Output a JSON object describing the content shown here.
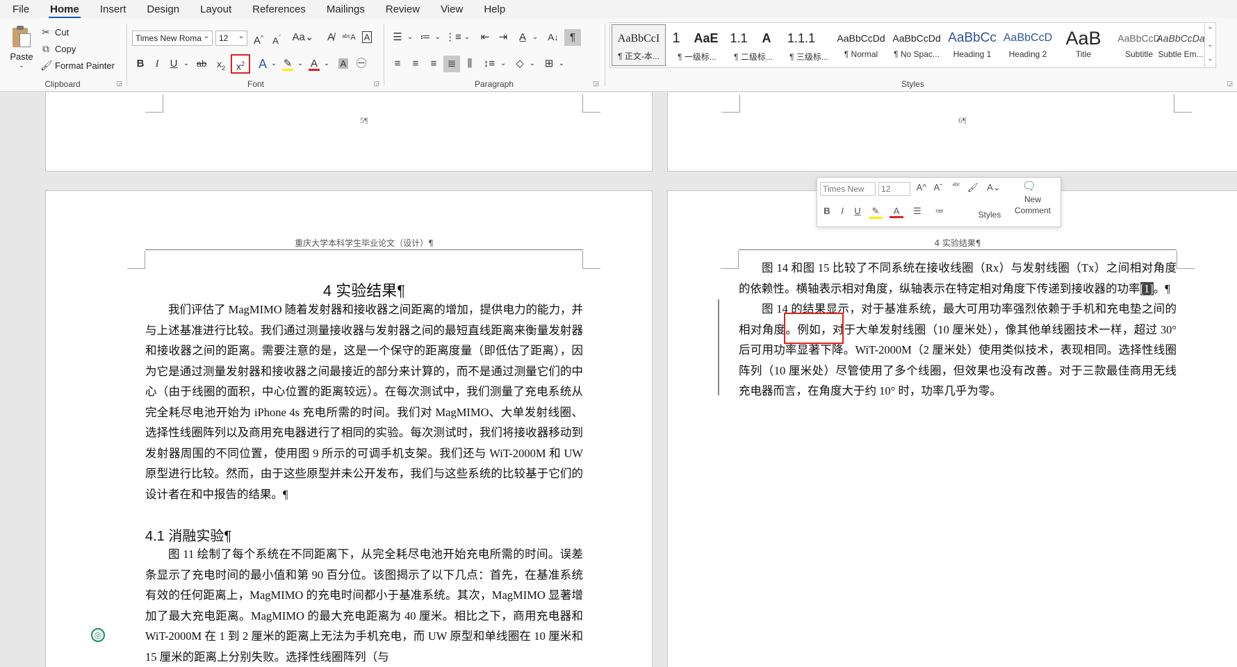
{
  "menu": [
    "File",
    "Home",
    "Insert",
    "Design",
    "Layout",
    "References",
    "Mailings",
    "Review",
    "View",
    "Help"
  ],
  "clipboard": {
    "paste_label": "Paste",
    "cut_label": "Cut",
    "copy_label": "Copy",
    "format_painter_label": "Format Painter",
    "group_label": "Clipboard"
  },
  "font": {
    "family": "Times New Roma",
    "size": "12",
    "group_label": "Font"
  },
  "paragraph": {
    "group_label": "Paragraph"
  },
  "styles": {
    "group_label": "Styles",
    "items": [
      {
        "sample": "AaBbCcI",
        "name": "¶ 正文-本..."
      },
      {
        "sample": "1",
        "name": "¶ 一级标..."
      },
      {
        "sample": "AaE",
        "name": "¶ 二级标..."
      },
      {
        "sample": "1.1",
        "name": "¶ 二级标..."
      },
      {
        "sample": "A",
        "name": "¶ 三级标..."
      },
      {
        "sample": "1.1.1",
        "name": "¶ 三级标..."
      },
      {
        "sample": "AaBbCcDd",
        "name": "¶ Normal"
      },
      {
        "sample": "AaBbCcDd",
        "name": "¶ No Spac..."
      },
      {
        "sample": "AaBbCc",
        "name": "Heading 1"
      },
      {
        "sample": "AaBbCcD",
        "name": "Heading 2"
      },
      {
        "sample": "AaB",
        "name": "Title"
      },
      {
        "sample": "AaBbCcD",
        "name": "Subtitle"
      },
      {
        "sample": "AaBbCcDa",
        "name": "Subtle Em..."
      }
    ]
  },
  "pages": {
    "top_left_num": "5¶",
    "top_right_num": "6¶",
    "left_header": "重庆大学本科学生毕业论文（设计）¶",
    "right_header": "4 实验结果¶",
    "chapter_title": "4 实验结果¶",
    "section_heading": "4.1 消融实验¶",
    "left_para1": "我们评估了 MagMIMO 随着发射器和接收器之间距离的增加，提供电力的能力，并与上述基准进行比较。我们通过测量接收器与发射器之间的最短直线距离来衡量发射器和接收器之间的距离。需要注意的是，这是一个保守的距离度量（即低估了距离），因为它是通过测量发射器和接收器之间最接近的部分来计算的，而不是通过测量它们的中心（由于线圈的面积，中心位置的距离较远）。在每次测试中，我们测量了充电系统从完全耗尽电池开始为 iPhone 4s 充电所需的时间。我们对 MagMIMO、大单发射线圈、选择性线圈阵列以及商用充电器进行了相同的实验。每次测试时，我们将接收器移动到发射器周围的不同位置，使用图 9 所示的可调手机支架。我们还与 WiT-2000M 和 UW 原型进行比较。然而，由于这些原型并未公开发布，我们与这些系统的比较基于它们的设计者在和中报告的结果。¶",
    "left_para2": "图 11 绘制了每个系统在不同距离下，从完全耗尽电池开始充电所需的时间。误差条显示了充电时间的最小值和第 90 百分位。该图揭示了以下几点：首先，在基准系统有效的任何距离上，MagMIMO 的充电时间都小于基准系统。其次，MagMIMO 显著增加了最大充电距离。MagMIMO 的最大充电距离为 40 厘米。相比之下，商用充电器和 WiT-2000M 在 1 到 2 厘米的距离上无法为手机充电，而 UW 原型和单线圈在 10 厘米和 15 厘米的距离上分别失败。选择性线圈阵列（与",
    "right_para1_a": "图 14 和图 15 比较了不同系统在接收线圈（Rx）与发射线圈（Tx）之间相对角度的依赖性。横轴表示相对角度，纵轴表示在特定相对角度下传递到接收器的功率",
    "right_para1_ref": "[1]",
    "right_para1_b": "。¶",
    "right_para2": "图 14 的结果显示，对于基准系统，最大可用功率强烈依赖于手机和充电垫之间的相对角度。例如，对于大单发射线圈（10 厘米处），像其他单线圈技术一样，超过 30° 后可用功率显著下降。WiT-2000M（2 厘米处）使用类似技术，表现相同。选择性线圈阵列（10 厘米处）尽管使用了多个线圈，但效果也没有改善。对于三款最佳商用无线充电器而言，在角度大于约 10° 时，功率几乎为零。"
  },
  "mini_toolbar": {
    "font": "Times New",
    "size": "12",
    "styles_label": "Styles",
    "new_comment_label1": "New",
    "new_comment_label2": "Comment"
  },
  "colors": {
    "accent": "#185abd",
    "highlight_box": "#e02020",
    "font_color_bar": "#e02020",
    "highlight_bar": "#ffee00"
  }
}
